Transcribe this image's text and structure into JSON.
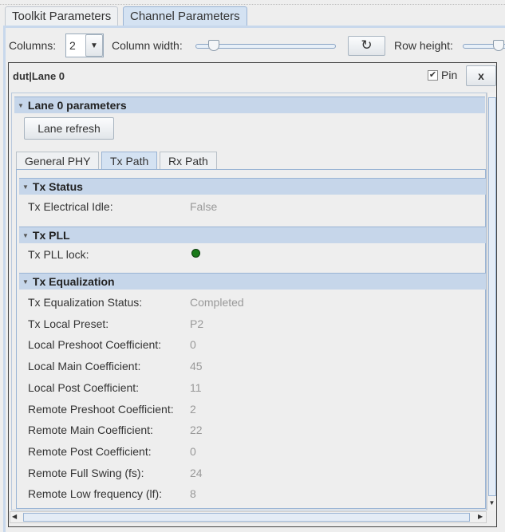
{
  "tabs": [
    {
      "label": "Toolkit Parameters"
    },
    {
      "label": "Channel Parameters"
    }
  ],
  "toolbar": {
    "columns_label": "Columns:",
    "columns_value": "2",
    "column_width_label": "Column width:",
    "refresh_icon": "↻",
    "row_height_label": "Row height:"
  },
  "panel": {
    "title": "dut|Lane 0",
    "pin_label": "Pin",
    "pin_checked": true,
    "close_label": "x"
  },
  "lane_section": {
    "title": "Lane 0 parameters",
    "refresh_button": "Lane refresh"
  },
  "subtabs": [
    {
      "label": "General PHY"
    },
    {
      "label": "Tx Path"
    },
    {
      "label": "Rx Path"
    }
  ],
  "sections": {
    "tx_status": {
      "title": "Tx Status",
      "rows": [
        {
          "label": "Tx Electrical Idle:",
          "value": "False"
        }
      ]
    },
    "tx_pll": {
      "title": "Tx PLL",
      "rows": [
        {
          "label": "Tx PLL lock:",
          "indicator_color": "#1a7a1a"
        }
      ]
    },
    "tx_eq": {
      "title": "Tx Equalization",
      "rows": [
        {
          "label": "Tx Equalization Status:",
          "value": "Completed"
        },
        {
          "label": "Tx Local Preset:",
          "value": "P2"
        },
        {
          "label": "Local Preshoot Coefficient:",
          "value": "0"
        },
        {
          "label": "Local Main Coefficient:",
          "value": "45"
        },
        {
          "label": "Local Post Coefficient:",
          "value": "11"
        },
        {
          "label": "Remote Preshoot Coefficient:",
          "value": "2"
        },
        {
          "label": "Remote Main Coefficient:",
          "value": "22"
        },
        {
          "label": "Remote Post Coefficient:",
          "value": "0"
        },
        {
          "label": "Remote Full Swing (fs):",
          "value": "24"
        },
        {
          "label": "Remote Low frequency (lf):",
          "value": "8"
        }
      ]
    }
  }
}
